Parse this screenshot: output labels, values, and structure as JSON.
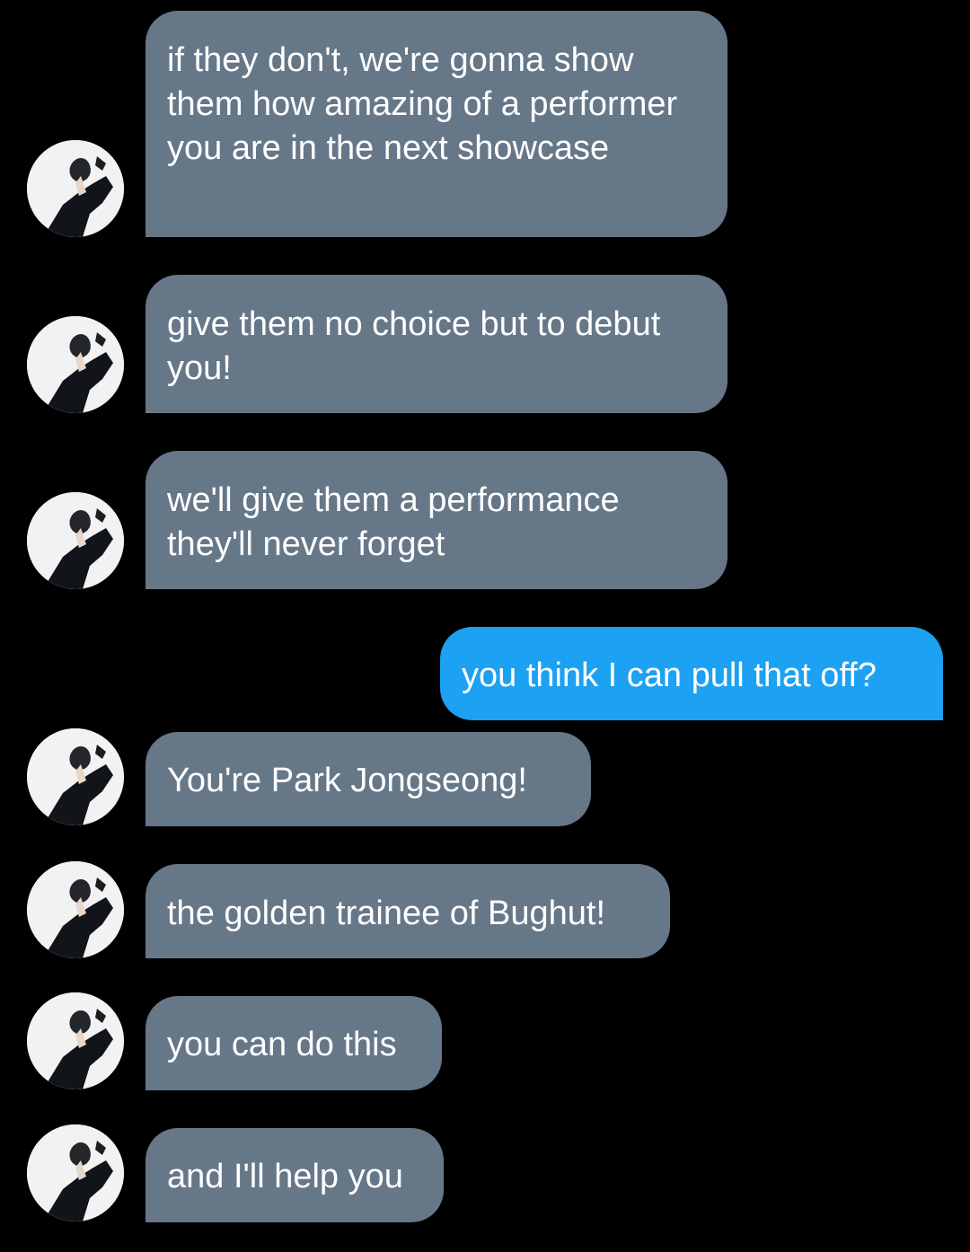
{
  "conversation": {
    "messages": [
      {
        "sender": "contact",
        "text": "if they don't, we're gonna show them how amazing of a performer you are in the next showcase"
      },
      {
        "sender": "contact",
        "text": "give them no choice but to debut you!"
      },
      {
        "sender": "contact",
        "text": "we'll give them a performance they'll never forget"
      },
      {
        "sender": "me",
        "text": "you think I can pull that off?"
      },
      {
        "sender": "contact",
        "text": "You're Park Jongseong!"
      },
      {
        "sender": "contact",
        "text": "the golden trainee of Bughut!"
      },
      {
        "sender": "contact",
        "text": "you can do this"
      },
      {
        "sender": "contact",
        "text": "and I'll help you"
      }
    ]
  },
  "colors": {
    "background": "#000000",
    "incoming_bubble": "#667788",
    "outgoing_bubble": "#1da1f2",
    "text": "#ffffff"
  },
  "icons": {
    "contact_avatar": "avatar-photo-icon"
  }
}
